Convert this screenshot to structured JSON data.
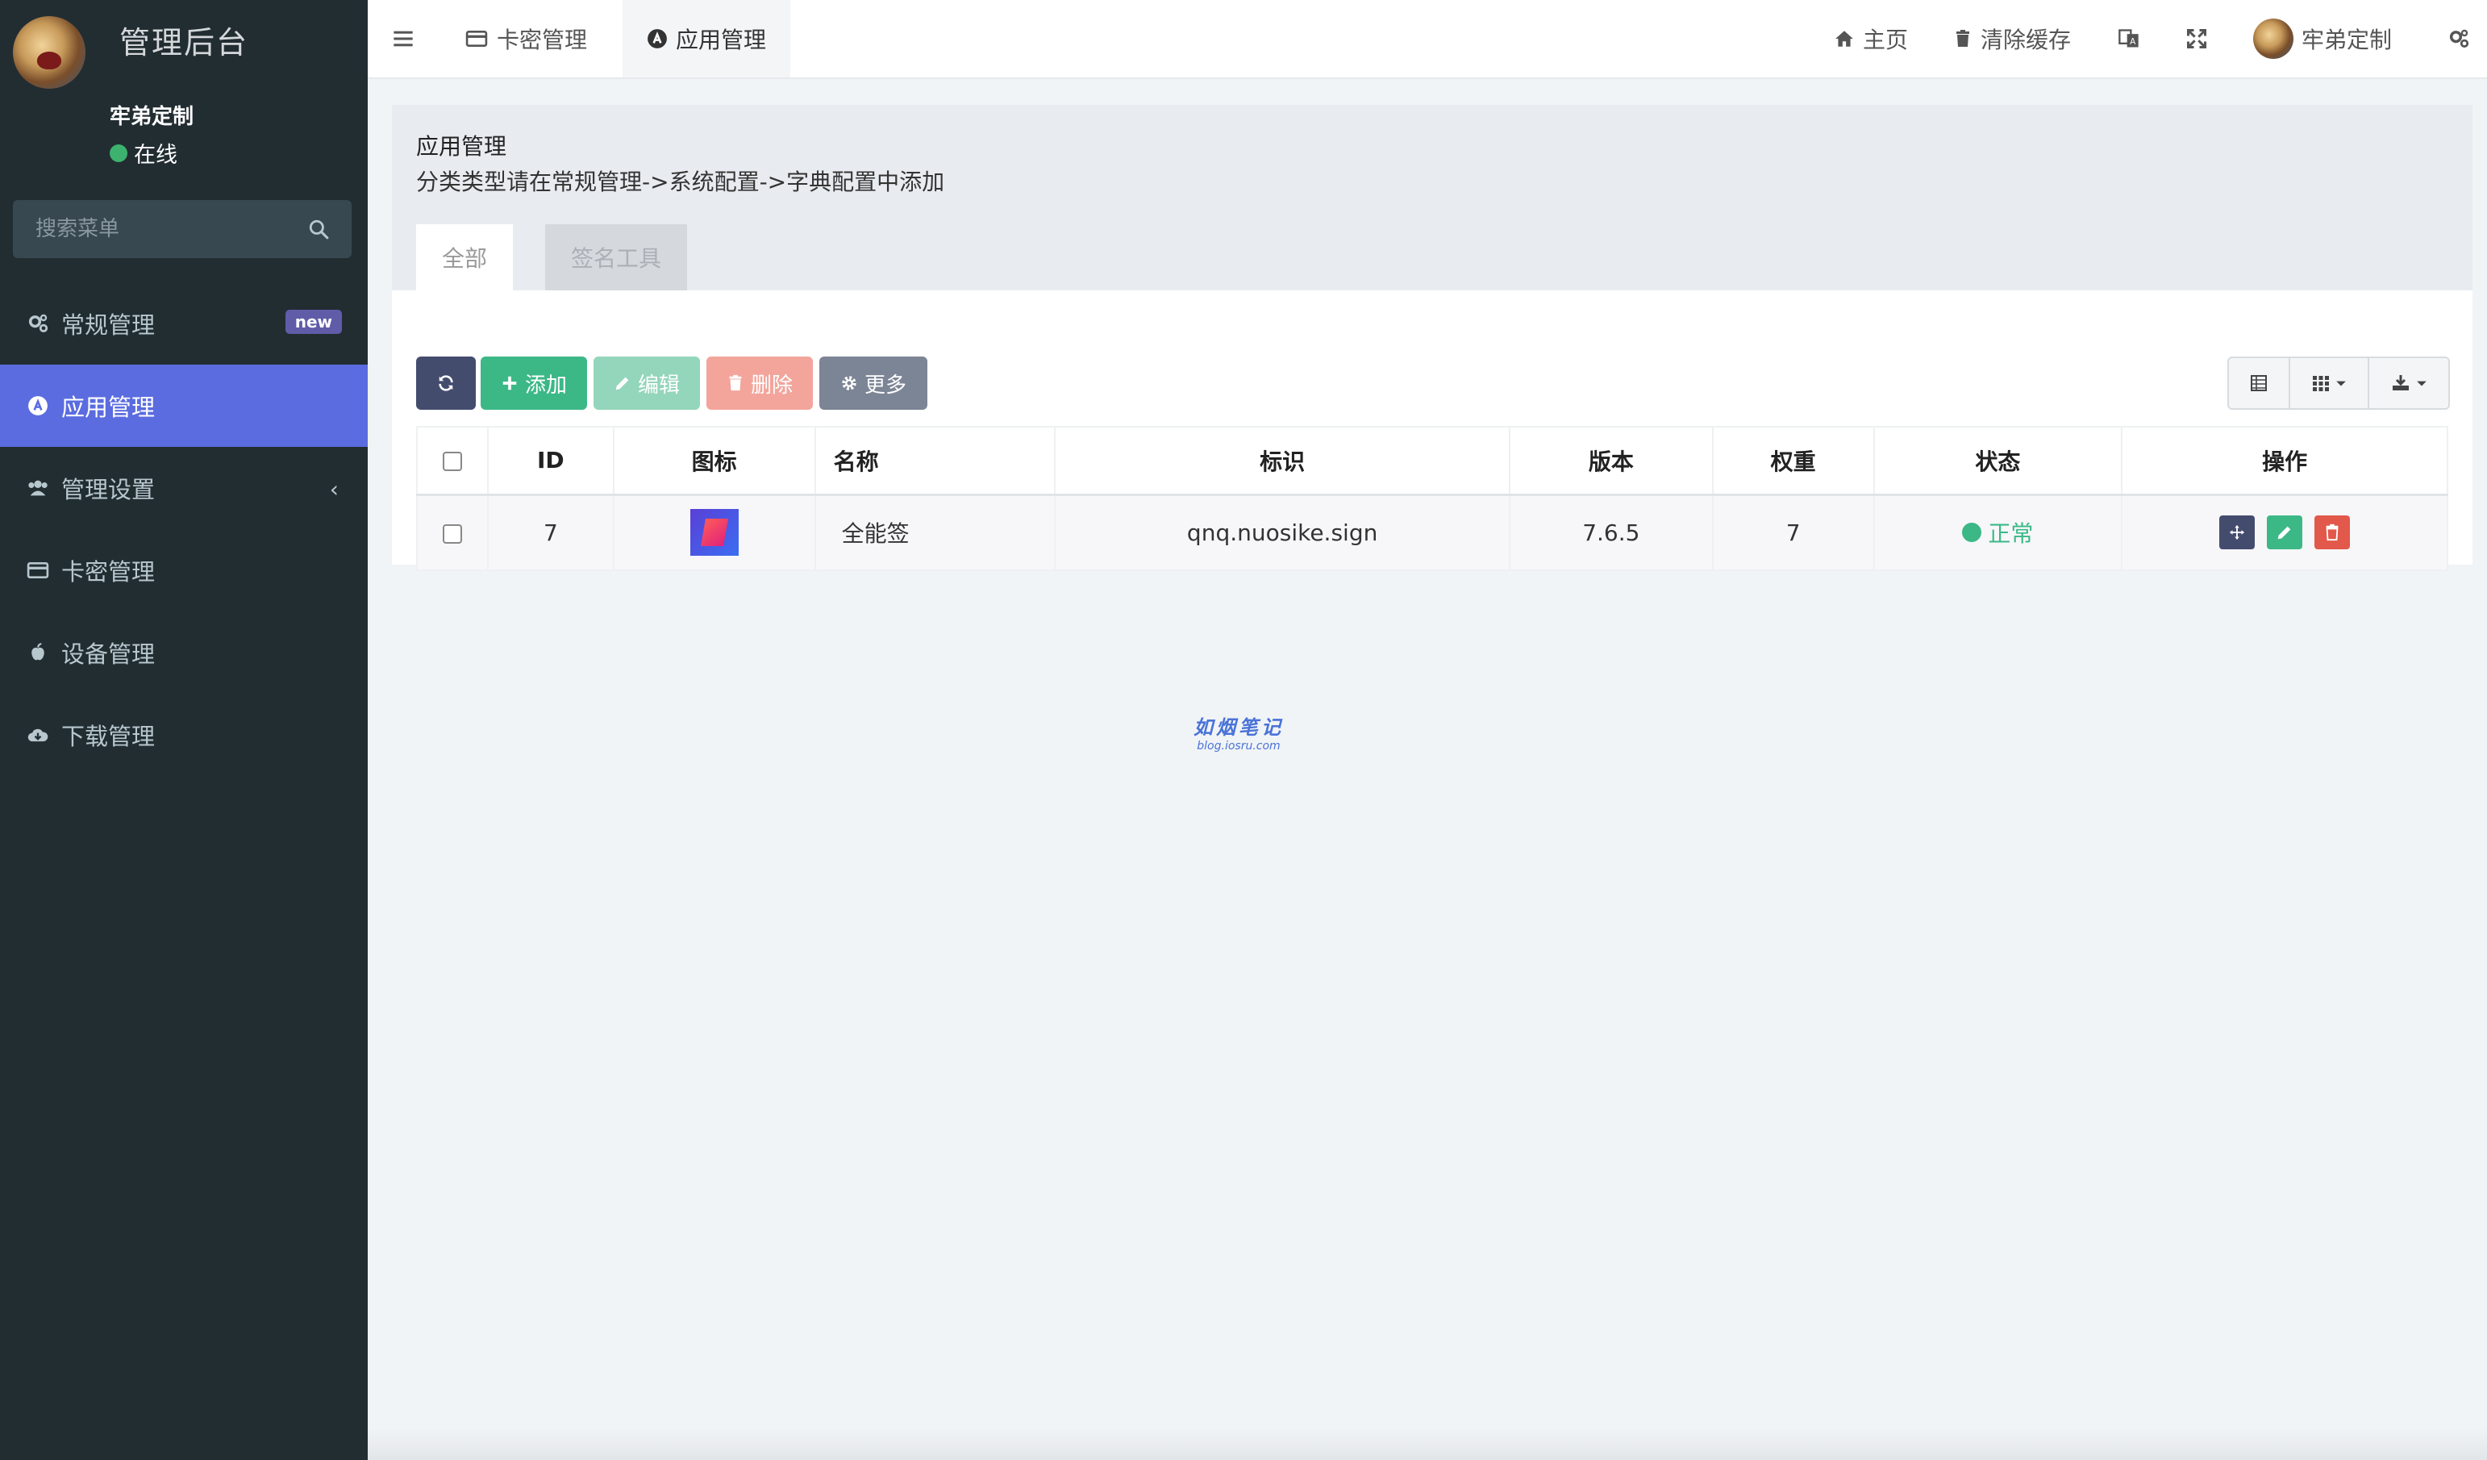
{
  "sidebar": {
    "logo": "管理后台",
    "user": {
      "name": "牢弟定制",
      "status": "在线"
    },
    "search_placeholder": "搜索菜单",
    "items": [
      {
        "label": "常规管理",
        "badge": "new",
        "icon": "cogs-icon"
      },
      {
        "label": "应用管理",
        "icon": "app-store-icon",
        "active": true
      },
      {
        "label": "管理设置",
        "icon": "users-icon",
        "has_children": true
      },
      {
        "label": "卡密管理",
        "icon": "credit-card-icon"
      },
      {
        "label": "设备管理",
        "icon": "apple-icon"
      },
      {
        "label": "下载管理",
        "icon": "cloud-download-icon"
      }
    ]
  },
  "topbar": {
    "tabs": [
      {
        "label": "卡密管理",
        "icon": "credit-card-icon"
      },
      {
        "label": "应用管理",
        "icon": "app-store-icon",
        "active": true
      }
    ],
    "home": "主页",
    "clear_cache": "清除缓存",
    "user_name": "牢弟定制"
  },
  "page": {
    "title": "应用管理",
    "subtitle": "分类类型请在常规管理->系统配置->字典配置中添加",
    "tabs": [
      "全部",
      "签名工具"
    ]
  },
  "toolbar": {
    "add": "添加",
    "edit": "编辑",
    "delete": "删除",
    "more": "更多"
  },
  "table": {
    "columns": [
      "ID",
      "图标",
      "名称",
      "标识",
      "版本",
      "权重",
      "状态",
      "操作"
    ],
    "rows": [
      {
        "id": "7",
        "name": "全能签",
        "identifier": "qnq.nuosike.sign",
        "version": "7.6.5",
        "weight": "7",
        "status": "正常"
      }
    ]
  },
  "watermark": {
    "title": "如烟笔记",
    "url": "blog.iosru.com"
  },
  "colors": {
    "sidebar_bg": "#222d32",
    "active_menu": "#5b6ce0",
    "success": "#3cb887",
    "danger": "#e2584a",
    "dark_btn": "#444c6e"
  }
}
